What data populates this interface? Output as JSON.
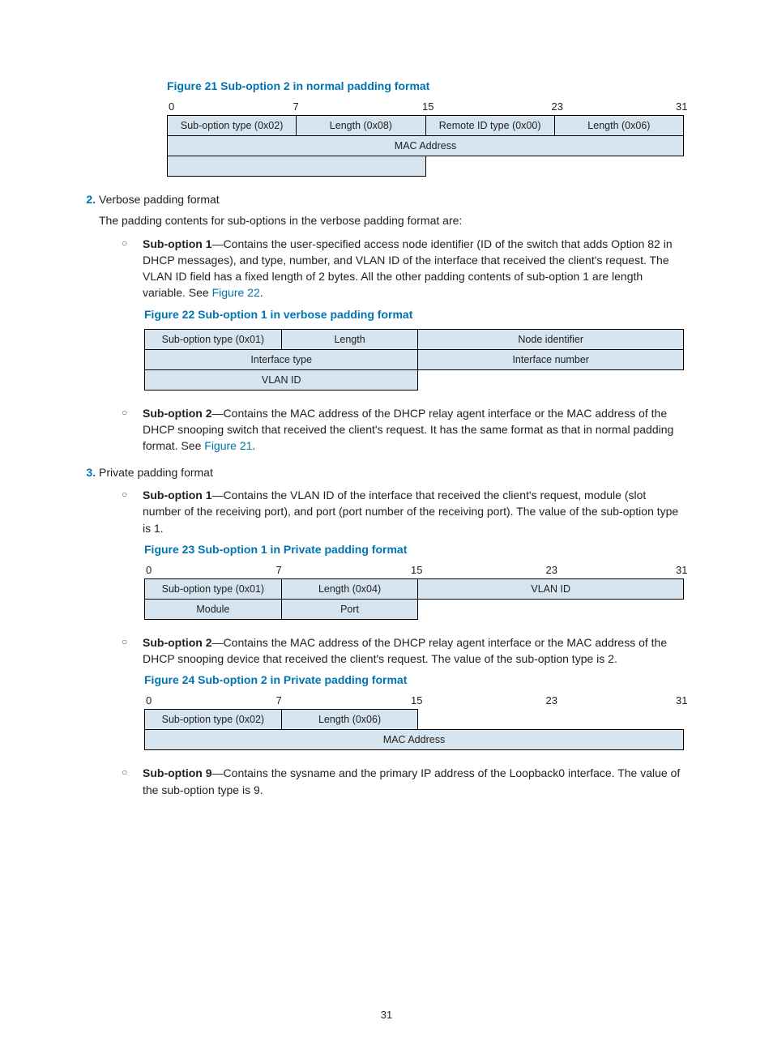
{
  "page_number": "31",
  "fig21": {
    "caption": "Figure 21 Sub-option 2 in normal padding format",
    "bits": [
      "0",
      "7",
      "15",
      "23",
      "31"
    ],
    "r1c1": "Sub-option type (0x02)",
    "r1c2": "Length (0x08)",
    "r1c3": "Remote ID type (0x00)",
    "r1c4": "Length (0x06)",
    "r2": "MAC Address"
  },
  "item2": {
    "title": "Verbose padding format",
    "intro": "The padding contents for sub-options in the verbose padding format are:",
    "sub1_label": "Sub-option 1",
    "sub1_text": "—Contains the user-specified access node identifier (ID of the switch that adds Option 82 in DHCP messages), and type, number, and VLAN ID of the interface that received the client's request. The VLAN ID field has a fixed length of 2 bytes. All the other padding contents of sub-option 1 are length variable. See ",
    "sub1_link": "Figure 22",
    "sub1_tail": ".",
    "sub2_label": "Sub-option 2",
    "sub2_text": "—Contains the MAC address of the DHCP relay agent interface or the MAC address of the DHCP snooping switch that received the client's request. It has the same format as that in normal padding format. See ",
    "sub2_link": "Figure 21",
    "sub2_tail": "."
  },
  "fig22": {
    "caption": "Figure 22 Sub-option 1 in verbose padding format",
    "r1c1": "Sub-option type (0x01)",
    "r1c2": "Length",
    "r1c3": "Node identifier",
    "r2c1": "Interface type",
    "r2c2": "Interface number",
    "r3c1": "VLAN ID"
  },
  "item3": {
    "title": "Private padding format",
    "sub1_label": "Sub-option 1",
    "sub1_text": "—Contains the VLAN ID of the interface that received the client's request, module (slot number of the receiving port), and port (port number of the receiving port). The value of the sub-option type is 1.",
    "sub2_label": "Sub-option 2",
    "sub2_text": "—Contains the MAC address of the DHCP relay agent interface or the MAC address of the DHCP snooping device that received the client's request. The value of the sub-option type is 2.",
    "sub9_label": "Sub-option 9",
    "sub9_text": "—Contains the sysname and the primary IP address of the Loopback0 interface. The value of the sub-option type is 9."
  },
  "fig23": {
    "caption": "Figure 23 Sub-option 1 in Private padding format",
    "bits": [
      "0",
      "7",
      "15",
      "23",
      "31"
    ],
    "r1c1": "Sub-option type (0x01)",
    "r1c2": "Length (0x04)",
    "r1c3": "VLAN ID",
    "r2c1": "Module",
    "r2c2": "Port"
  },
  "fig24": {
    "caption": "Figure 24  Sub-option 2 in Private padding format",
    "bits": [
      "0",
      "7",
      "15",
      "23",
      "31"
    ],
    "r1c1": "Sub-option type (0x02)",
    "r1c2": "Length (0x06)",
    "r2": "MAC Address"
  }
}
